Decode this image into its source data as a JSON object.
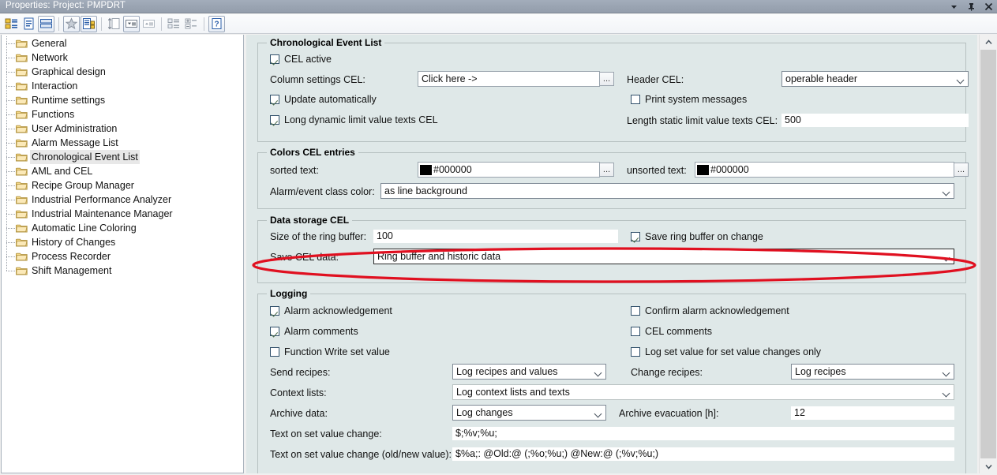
{
  "window": {
    "title": "Properties: Project: PMPDRT",
    "controls": [
      {
        "name": "dropdown-menu-icon",
        "glyph": "▼"
      },
      {
        "name": "auto-hide-pin-icon",
        "glyph": "pin"
      },
      {
        "name": "close-icon",
        "glyph": "✕"
      }
    ]
  },
  "toolbar": {
    "buttons": [
      {
        "name": "properties-view-icon",
        "framed": false
      },
      {
        "name": "document-view-icon",
        "framed": false
      },
      {
        "name": "list-view-icon",
        "framed": true
      },
      {
        "name": "favorites-star-icon",
        "framed": true
      },
      {
        "name": "object-list-icon",
        "framed": true
      },
      {
        "name": "sort-icon",
        "framed": false
      },
      {
        "name": "sort-descending-icon",
        "framed": true
      },
      {
        "name": "sort-ascending-icon",
        "framed": false
      },
      {
        "name": "group-icon",
        "framed": false
      },
      {
        "name": "expand-collapse-icon",
        "framed": false
      },
      {
        "name": "help-icon",
        "framed": true
      }
    ]
  },
  "tree": {
    "items": [
      {
        "label": "General",
        "selected": false
      },
      {
        "label": "Network",
        "selected": false
      },
      {
        "label": "Graphical design",
        "selected": false
      },
      {
        "label": "Interaction",
        "selected": false
      },
      {
        "label": "Runtime settings",
        "selected": false
      },
      {
        "label": "Functions",
        "selected": false
      },
      {
        "label": "User Administration",
        "selected": false
      },
      {
        "label": "Alarm Message List",
        "selected": false
      },
      {
        "label": "Chronological Event List",
        "selected": true
      },
      {
        "label": "AML and CEL",
        "selected": false
      },
      {
        "label": "Recipe Group Manager",
        "selected": false
      },
      {
        "label": "Industrial Performance Analyzer",
        "selected": false
      },
      {
        "label": "Industrial Maintenance Manager",
        "selected": false
      },
      {
        "label": "Automatic Line Coloring",
        "selected": false
      },
      {
        "label": "History of Changes",
        "selected": false
      },
      {
        "label": "Process Recorder",
        "selected": false
      },
      {
        "label": "Shift Management",
        "selected": false
      }
    ]
  },
  "groups": {
    "cel": {
      "legend": "Chronological Event List",
      "cel_active_label": "CEL active",
      "cel_active_checked": true,
      "column_settings_label": "Column settings CEL:",
      "column_settings_value": "Click here ->",
      "column_settings_button": "...",
      "header_cel_label": "Header CEL:",
      "header_cel_value": "operable header",
      "update_automatically_label": "Update automatically",
      "update_automatically_checked": true,
      "print_system_messages_label": "Print system messages",
      "print_system_messages_checked": false,
      "long_dynamic_label": "Long dynamic limit value texts CEL",
      "long_dynamic_checked": true,
      "length_static_label": "Length static limit value texts CEL:",
      "length_static_value": "500"
    },
    "colors": {
      "legend": "Colors CEL entries",
      "sorted_label": "sorted text:",
      "sorted_value": "#000000",
      "sorted_swatch": "#000000",
      "sorted_button": "...",
      "unsorted_label": "unsorted text:",
      "unsorted_value": "#000000",
      "unsorted_swatch": "#000000",
      "unsorted_button": "...",
      "alarm_class_label": "Alarm/event class color:",
      "alarm_class_value": "as line background"
    },
    "storage": {
      "legend": "Data storage CEL",
      "ring_buffer_label": "Size of the ring buffer:",
      "ring_buffer_value": "100",
      "save_ring_buffer_label": "Save ring buffer on change",
      "save_ring_buffer_checked": true,
      "save_cel_label": "Save CEL data:",
      "save_cel_value": "Ring buffer and historic data",
      "highlight_color": "#e01020"
    },
    "logging": {
      "legend": "Logging",
      "alarm_ack_label": "Alarm acknowledgement",
      "alarm_ack_checked": true,
      "confirm_ack_label": "Confirm alarm acknowledgement",
      "confirm_ack_checked": false,
      "alarm_comments_label": "Alarm comments",
      "alarm_comments_checked": true,
      "cel_comments_label": "CEL comments",
      "cel_comments_checked": false,
      "function_write_label": "Function Write set value",
      "function_write_checked": false,
      "log_set_value_label": "Log set value for set value changes only",
      "log_set_value_checked": false,
      "send_recipes_label": "Send recipes:",
      "send_recipes_value": "Log recipes and values",
      "change_recipes_label": "Change recipes:",
      "change_recipes_value": "Log recipes",
      "context_lists_label": "Context lists:",
      "context_lists_value": "Log context lists and texts",
      "archive_data_label": "Archive data:",
      "archive_data_value": "Log changes",
      "archive_evac_label": "Archive evacuation [h]:",
      "archive_evac_value": "12",
      "text_set_value_label": "Text on set value change:",
      "text_set_value_value": "$;%v;%u;",
      "text_old_new_label": "Text on set value change (old/new value):",
      "text_old_new_value": "$%a;: @Old:@ (;%o;%u;)  @New:@ (;%v;%u;)"
    }
  }
}
